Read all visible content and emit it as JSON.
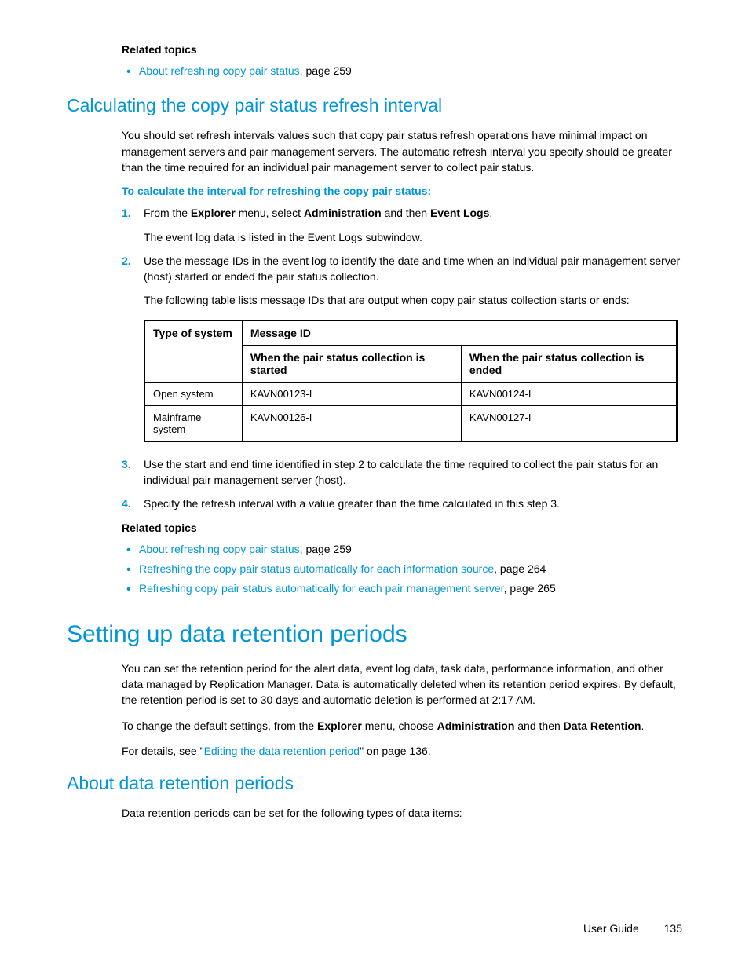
{
  "related1": {
    "heading": "Related topics",
    "items": [
      {
        "link": "About refreshing copy pair status",
        "suffix": ", page 259"
      }
    ]
  },
  "section1": {
    "title": "Calculating the copy pair status refresh interval",
    "intro": "You should set refresh intervals values such that copy pair status refresh operations have minimal impact on management servers and pair management servers. The automatic refresh interval you specify should be greater than the time required for an individual pair management server to collect pair status.",
    "procedure_heading": "To calculate the interval for refreshing the copy pair status:",
    "step1_prefix": "From the ",
    "step1_b1": "Explorer",
    "step1_mid1": " menu, select ",
    "step1_b2": "Administration",
    "step1_mid2": " and then ",
    "step1_b3": "Event Logs",
    "step1_suffix": ".",
    "step1_sub": "The event log data is listed in the Event Logs subwindow.",
    "step2_main": "Use the message IDs in the event log to identify the date and time when an individual pair management server (host) started or ended the pair status collection.",
    "step2_sub": "The following table lists message IDs that are output when copy pair status collection starts or ends:",
    "step3": "Use the start and end time identified in step 2 to calculate the time required to collect the pair status for an individual pair management server (host).",
    "step4": "Specify the refresh interval with a value greater than the time calculated in this step 3."
  },
  "table": {
    "col_type": "Type of system",
    "col_msgid": "Message ID",
    "col_started": "When the pair status collection is started",
    "col_ended": "When the pair status collection is ended",
    "rows": [
      {
        "type": "Open system",
        "started": "KAVN00123-I",
        "ended": "KAVN00124-I"
      },
      {
        "type": "Mainframe system",
        "started": "KAVN00126-I",
        "ended": "KAVN00127-I"
      }
    ]
  },
  "related2": {
    "heading": "Related topics",
    "items": [
      {
        "link": "About refreshing copy pair status",
        "suffix": ", page 259"
      },
      {
        "link": "Refreshing the copy pair status automatically for each information source",
        "suffix": ", page 264"
      },
      {
        "link": "Refreshing copy pair status automatically for each pair management server",
        "suffix": ", page 265"
      }
    ]
  },
  "section2": {
    "title": "Setting up data retention periods",
    "p1": "You can set the retention period for the alert data, event log data, task data, performance information, and other data managed by Replication Manager. Data is automatically deleted when its retention period expires. By default, the retention period is set to 30 days and automatic deletion is performed at 2:17 AM.",
    "p2_prefix": "To change the default settings, from the ",
    "p2_b1": "Explorer",
    "p2_mid1": " menu, choose ",
    "p2_b2": "Administration",
    "p2_mid2": " and then ",
    "p2_b3": "Data Retention",
    "p2_suffix": ".",
    "p3_prefix": "For details, see \"",
    "p3_link": "Editing the data retention period",
    "p3_suffix": "\" on page 136."
  },
  "section3": {
    "title": "About data retention periods",
    "p1": "Data retention periods can be set for the following types of data items:"
  },
  "footer": {
    "guide": "User Guide",
    "page": "135"
  }
}
